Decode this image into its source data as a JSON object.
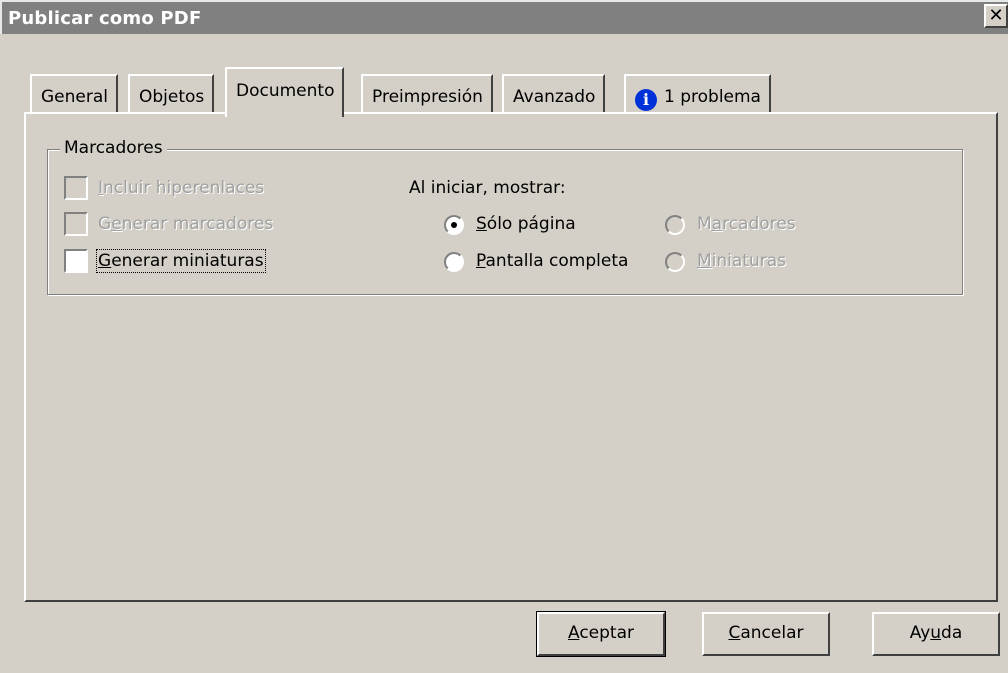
{
  "window": {
    "title": "Publicar como PDF",
    "close_glyph": "✕"
  },
  "tabs": [
    {
      "label": "General"
    },
    {
      "label": "Objetos"
    },
    {
      "label": "Documento",
      "active": true
    },
    {
      "label": "Preimpresión"
    },
    {
      "label": "Avanzado"
    },
    {
      "label": "1 problema",
      "icon": "info-icon"
    }
  ],
  "bookmarks_group": {
    "legend": "Marcadores",
    "checkboxes": [
      {
        "label": "Incluir hiperenlaces",
        "checked": false,
        "enabled": false
      },
      {
        "label": "Generar marcadores",
        "checked": false,
        "enabled": false
      },
      {
        "label": "Generar miniaturas",
        "checked": false,
        "enabled": true
      }
    ],
    "startup": {
      "label": "Al iniciar, mostrar:",
      "options": [
        {
          "label": "Sólo página",
          "selected": true,
          "enabled": true
        },
        {
          "label": "Pantalla completa",
          "selected": false,
          "enabled": true
        },
        {
          "label": "Marcadores",
          "selected": false,
          "enabled": false
        },
        {
          "label": "Miniaturas",
          "selected": false,
          "enabled": false
        }
      ]
    }
  },
  "buttons": {
    "ok": "Aceptar",
    "cancel": "Cancelar",
    "help": "Ayuda"
  },
  "colors": {
    "face": "#d4d0c8",
    "title_bar": "#808080",
    "info_icon": "#0030d8"
  }
}
